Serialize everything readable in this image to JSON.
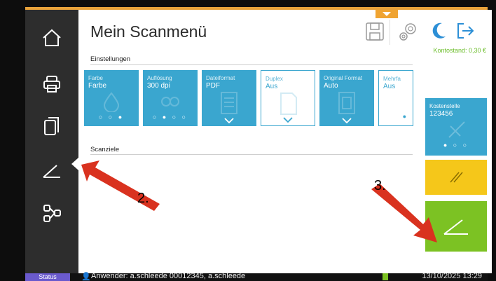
{
  "header": {
    "title": "Mein Scanmenü",
    "account_balance": "Kontostand: 0,30 €"
  },
  "sidebar": {
    "items": [
      {
        "name": "home",
        "icon": "home-icon"
      },
      {
        "name": "print",
        "icon": "printer-icon"
      },
      {
        "name": "copy",
        "icon": "copy-icon"
      },
      {
        "name": "scan",
        "icon": "scan-icon",
        "active": true
      },
      {
        "name": "workflow",
        "icon": "workflow-icon"
      }
    ]
  },
  "sections": {
    "settings": "Einstellungen",
    "targets": "Scanziele"
  },
  "tiles": [
    {
      "label": "Farbe",
      "value": "Farbe",
      "indicator": "○ ○ ●"
    },
    {
      "label": "Auflösung",
      "value": "300 dpi",
      "indicator": "○ ● ○ ○"
    },
    {
      "label": "Dateiformat",
      "value": "PDF",
      "indicator": "chevron"
    },
    {
      "label": "Duplex",
      "value": "Aus",
      "indicator": "chevron"
    },
    {
      "label": "Original Format",
      "value": "Auto",
      "indicator": "chevron"
    },
    {
      "label": "Mehrfa",
      "value": "Aus",
      "indicator": "●"
    }
  ],
  "right_panel": {
    "cost_center_label": "Kostenstelle",
    "cost_center_value": "123456",
    "cost_center_indicator": "● ○ ○"
  },
  "annotations": {
    "step2": "2.",
    "step3": "3."
  },
  "statusbar": {
    "status_label": "Status",
    "user": "Anwender: a.schleede 00012345, a.schleede",
    "datetime": "13/10/2025 13:29"
  },
  "colors": {
    "accent_blue": "#3aa6cf",
    "green": "#7cc223",
    "yellow": "#f5c71a",
    "orange": "#f0a432",
    "arrow_red": "#d9321f",
    "status_purple": "#6a5acd"
  }
}
